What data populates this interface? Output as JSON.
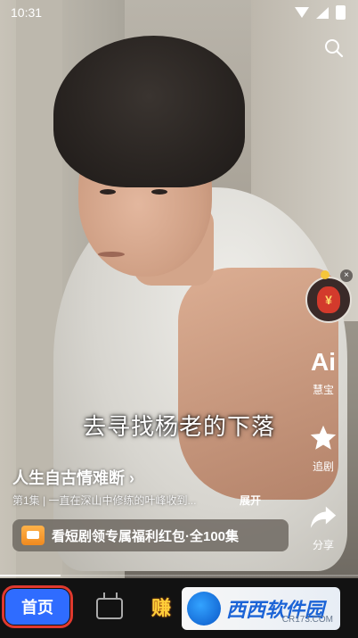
{
  "status_bar": {
    "time": "10:31"
  },
  "video": {
    "subtitle": "去寻找杨老的下落",
    "progress": 0.17
  },
  "drama": {
    "title": "人生自古情难断",
    "title_chevron": "›",
    "episode_desc": "第1集 | 一直在深山中修练的叶峰收到...",
    "expand_label": "展开"
  },
  "promo": {
    "text": "看短剧领专属福利红包·全100集"
  },
  "side_actions": {
    "red_bag_symbol": "¥",
    "close_symbol": "×",
    "ai_label": "慧宝",
    "ai_glyph": "Ai",
    "follow_label": "追剧",
    "share_label": "分享"
  },
  "bottom_nav": {
    "home_label": "首页",
    "earn_label": "赚"
  },
  "watermark": {
    "text": "西西软件园",
    "sub": "CR173.COM"
  },
  "colors": {
    "accent": "#2f6cff",
    "highlight_border": "#e0392f"
  }
}
